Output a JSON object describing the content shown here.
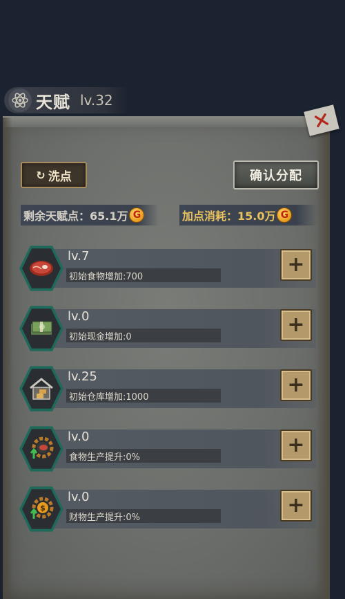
{
  "header": {
    "title": "天赋",
    "level": "lv.32"
  },
  "actions": {
    "reset_label": "洗点",
    "confirm_label": "确认分配"
  },
  "stats": {
    "remaining_label": "剩余天赋点：65.1万",
    "cost_label": "加点消耗：15.0万",
    "coin_symbol": "G"
  },
  "talents": [
    {
      "icon": "meat-icon",
      "level": "lv.7",
      "desc": "初始食物增加:700"
    },
    {
      "icon": "cash-icon",
      "level": "lv.0",
      "desc": "初始现金增加:0"
    },
    {
      "icon": "warehouse-icon",
      "level": "lv.25",
      "desc": "初始仓库增加:1000"
    },
    {
      "icon": "food-production-gear-icon",
      "level": "lv.0",
      "desc": "食物生产提升:0%"
    },
    {
      "icon": "money-production-gear-icon",
      "level": "lv.0",
      "desc": "财物生产提升:0%"
    }
  ],
  "plus_symbol": "+",
  "colors": {
    "hex_border": "#1e6a5a",
    "gold_text": "#e8c25c",
    "button_gold": "#b49a6a"
  }
}
